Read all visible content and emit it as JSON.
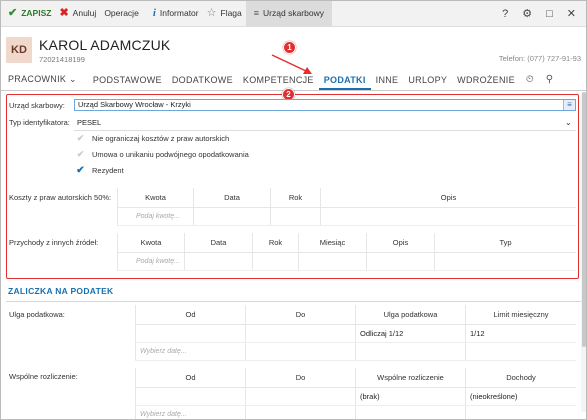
{
  "toolbar": {
    "save": "ZAPISZ",
    "cancel": "Anuluj",
    "operations": "Operacje",
    "informator": "Informator",
    "flag": "Flaga",
    "active_view": "Urząd skarbowy",
    "help_icon": "?",
    "settings_icon": "⚙",
    "minimize_icon": "□",
    "close_icon": "✕"
  },
  "employee": {
    "initials": "KD",
    "name": "KAROL ADAMCZUK",
    "id": "72021418199",
    "phone": "Telefon: (077) 727-91-93"
  },
  "tabs": [
    "PRACOWNIK ⌄",
    "PODSTAWOWE",
    "DODATKOWE",
    "KOMPETENCJE",
    "PODATKI",
    "INNE",
    "URLOPY",
    "WDROŻENIE"
  ],
  "active_tab": "PODATKI",
  "badges": {
    "one": "1",
    "two": "2"
  },
  "form": {
    "urzad_label": "Urząd skarbowy:",
    "urzad_value": "Urząd Skarbowy Wrocław - Krzyki",
    "id_type_label": "Typ identyfikatora:",
    "id_type_value": "PESEL",
    "checkboxes": [
      {
        "label": "Nie ograniczaj kosztów z praw autorskich",
        "checked": false
      },
      {
        "label": "Umowa o unikaniu podwójnego opodatkowania",
        "checked": false
      },
      {
        "label": "Rezydent",
        "checked": true
      }
    ],
    "koszty_label": "Koszty z praw autorskich 50%:",
    "koszty_headers": [
      "Kwota",
      "Data",
      "Rok",
      "Opis"
    ],
    "koszty_placeholder": "Podaj kwotę...",
    "przychody_label": "Przychody z innych źródeł:",
    "przychody_headers": [
      "Kwota",
      "Data",
      "Rok",
      "Miesiąc",
      "Opis",
      "Typ"
    ],
    "przychody_placeholder": "Podaj kwotę..."
  },
  "zaliczka": {
    "title": "ZALICZKA NA PODATEK",
    "ulga_label": "Ulga podatkowa:",
    "ulga_headers": [
      "Od",
      "Do",
      "Ulga podatkowa",
      "Limit miesięczny"
    ],
    "ulga_row": [
      "",
      "",
      "Odliczaj 1/12",
      "1/12"
    ],
    "ulga_placeholder": "Wybierz datę...",
    "wspolne_label": "Wspólne rozliczenie:",
    "wspolne_headers": [
      "Od",
      "Do",
      "Wspólne rozliczenie",
      "Dochody"
    ],
    "wspolne_row": [
      "",
      "",
      "(brak)",
      "(nieokreślone)"
    ],
    "wspolne_placeholder": "Wybierz datę..."
  }
}
